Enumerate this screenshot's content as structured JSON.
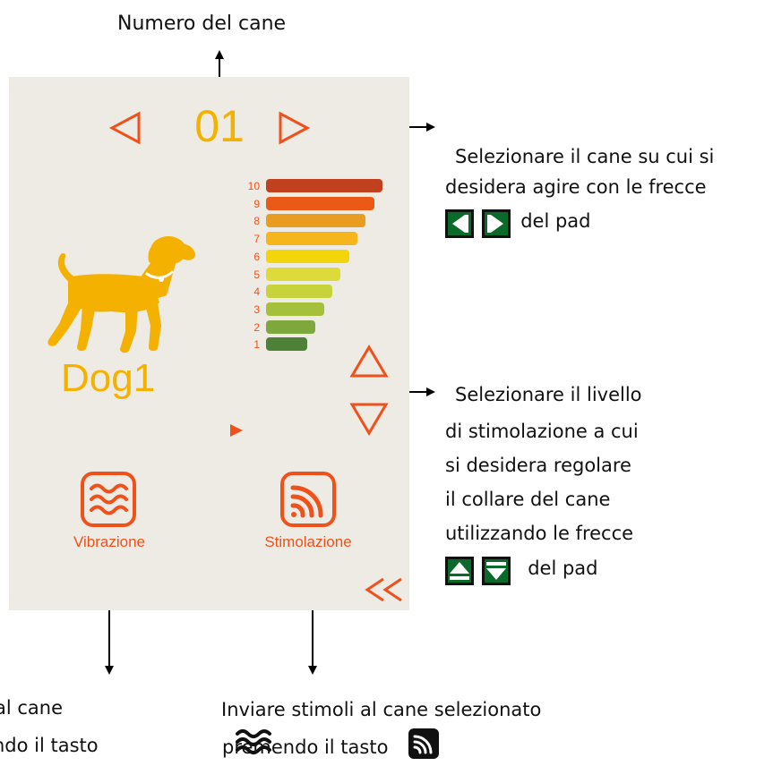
{
  "header": {
    "dog_number_label": "Numero del cane"
  },
  "screen": {
    "dog_counter": "01",
    "dog_name": "Dog1",
    "prev_dog_icon": "triangle-left-outline",
    "next_dog_icon": "triangle-right-outline",
    "level_up_icon": "triangle-up-outline",
    "level_down_icon": "triangle-down-outline",
    "back_icon": "double-chevron-left",
    "dog_icon": "dog-silhouette",
    "selected_level": 1,
    "levels": [
      {
        "num": "10",
        "color": "#c1411e"
      },
      {
        "num": "9",
        "color": "#ea5a16"
      },
      {
        "num": "8",
        "color": "#e89c20"
      },
      {
        "num": "7",
        "color": "#f6b51b"
      },
      {
        "num": "6",
        "color": "#f2d50a"
      },
      {
        "num": "5",
        "color": "#dcdb3a"
      },
      {
        "num": "4",
        "color": "#c6d33a"
      },
      {
        "num": "3",
        "color": "#a5c13c"
      },
      {
        "num": "2",
        "color": "#7fa83c"
      },
      {
        "num": "1",
        "color": "#4e8038"
      }
    ],
    "vibration_button": {
      "label": "Vibrazione",
      "icon": "vibration-waves-icon"
    },
    "stimulation_button": {
      "label": "Stimolazione",
      "icon": "stimulation-signal-icon"
    },
    "accent_color": "#f0511b",
    "primary_color": "#f5b100"
  },
  "annotations": {
    "select_dog_line1": "Selezionare il cane su cui si",
    "select_dog_line2": "desidera agire con le frecce",
    "select_dog_line3": "del pad",
    "select_level_line1": "Selezionare il livello",
    "select_level_line2": "di stimolazione a cui",
    "select_level_line3": "si desidera regolare",
    "select_level_line4": "il collare del cane",
    "select_level_line5": "utilizzando le frecce",
    "select_level_line6": "del pad",
    "vibration_line1": "al cane",
    "vibration_line2": "ndo il tasto",
    "stimulation_line1": "Inviare stimoli al cane selezionato",
    "stimulation_line2": "premendo il tasto"
  }
}
